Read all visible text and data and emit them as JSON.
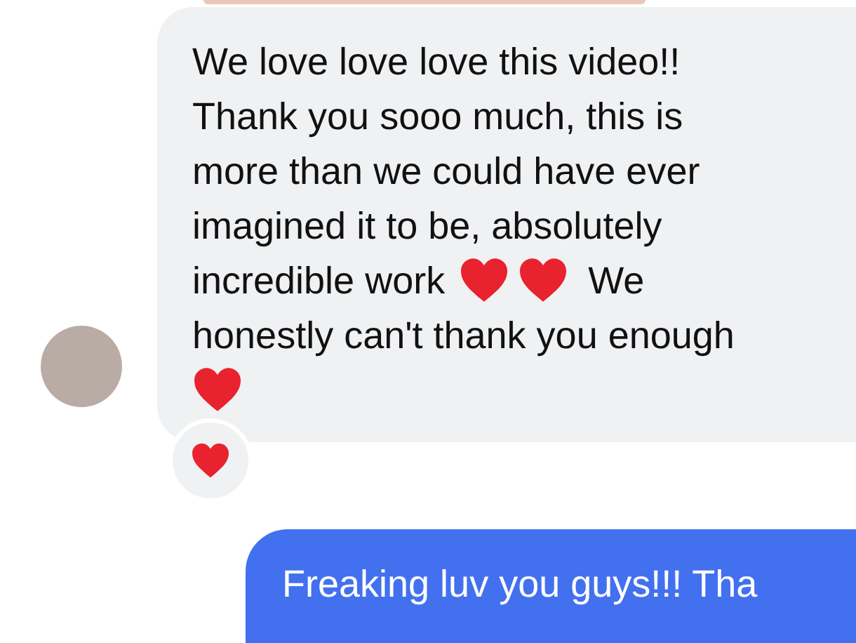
{
  "incoming_message": {
    "lines": [
      [
        {
          "kind": "text",
          "text": "We love love love this video!!"
        }
      ],
      [
        {
          "kind": "text",
          "text": "Thank you sooo much, this is"
        }
      ],
      [
        {
          "kind": "text",
          "text": "more than we could have ever"
        }
      ],
      [
        {
          "kind": "text",
          "text": "imagined it to be, absolutely"
        }
      ],
      [
        {
          "kind": "text",
          "text": "incredible work"
        },
        {
          "kind": "heart"
        },
        {
          "kind": "heart"
        },
        {
          "kind": "text",
          "text": "We"
        }
      ],
      [
        {
          "kind": "text",
          "text": "honestly can't thank you enough"
        }
      ],
      [
        {
          "kind": "heart"
        }
      ]
    ],
    "reaction": {
      "kind": "heart"
    }
  },
  "outgoing_message": {
    "text": "Freaking luv you guys!!! Tha"
  }
}
